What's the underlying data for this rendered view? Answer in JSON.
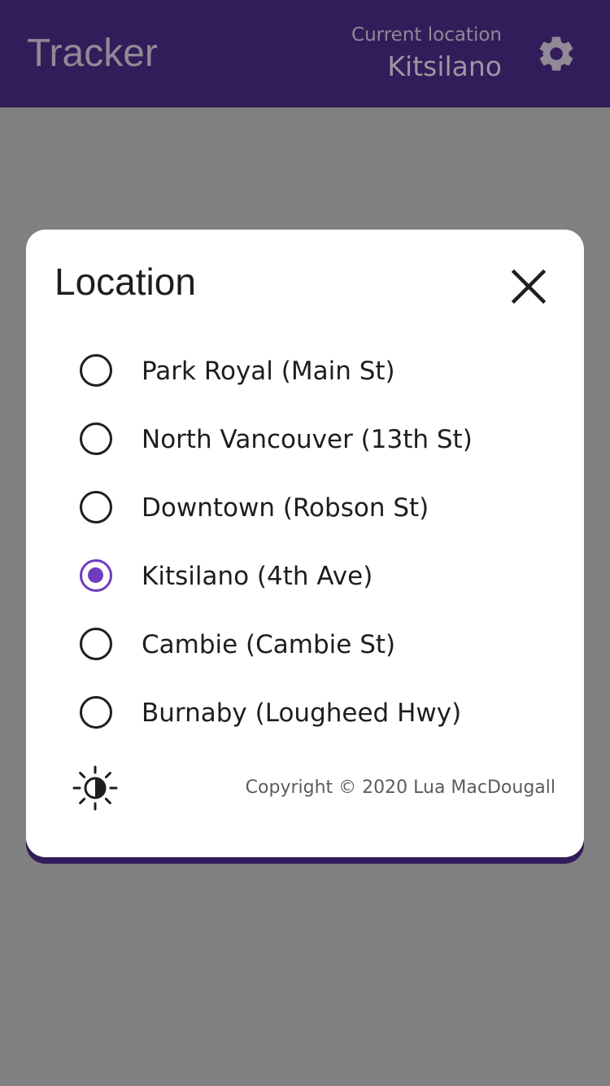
{
  "app": {
    "title": "Tracker",
    "current_location_caption": "Current location",
    "current_location_value": "Kitsilano",
    "settings_icon": "gear-icon"
  },
  "dialog": {
    "title": "Location",
    "close_icon": "close-icon",
    "options": [
      {
        "label": "Park Royal (Main St)",
        "selected": false
      },
      {
        "label": "North Vancouver (13th St)",
        "selected": false
      },
      {
        "label": "Downtown (Robson St)",
        "selected": false
      },
      {
        "label": "Kitsilano (4th Ave)",
        "selected": true
      },
      {
        "label": "Cambie (Cambie St)",
        "selected": false
      },
      {
        "label": "Burnaby (Lougheed Hwy)",
        "selected": false
      }
    ],
    "theme_icon": "brightness-contrast-icon",
    "copyright": "Copyright © 2020 Lua MacDougall"
  },
  "colors": {
    "appbar": "#331c5a",
    "accent": "#6f3cc0",
    "scrim": "#808080",
    "dialog_bg": "#ffffff"
  }
}
